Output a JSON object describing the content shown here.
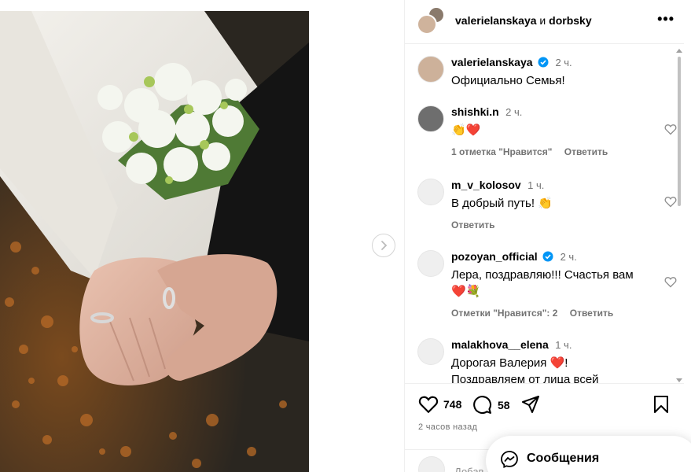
{
  "post": {
    "owner1": "valerielanskaya",
    "conj": "и",
    "owner2": "dorbsky",
    "more": "•••"
  },
  "comments": [
    {
      "user": "valerielanskaya",
      "time": "2 ч.",
      "text": "Официально Семья!",
      "verified": true
    },
    {
      "user": "shishki.n",
      "time": "2 ч.",
      "text": "👏❤️",
      "likes": "1 отметка \"Нравится\"",
      "reply": "Ответить"
    },
    {
      "user": "m_v_kolosov",
      "time": "1 ч.",
      "text": "В добрый путь! 👏",
      "reply": "Ответить"
    },
    {
      "user": "pozoyan_official",
      "time": "2 ч.",
      "text": "Лера, поздравляю!!! Счастья вам❤️💐",
      "likes": "Отметки \"Нравится\": 2",
      "reply": "Ответить",
      "verified": true
    },
    {
      "user": "malakhova__elena",
      "time": "1 ч.",
      "text": "Дорогая Валерия ❤️!",
      "text2": "Поздравляем от лица всей"
    }
  ],
  "actions": {
    "like_count": "748",
    "comment_count": "58",
    "posted_ago": "2 часов назад"
  },
  "add_comment": {
    "placeholder": "Добав"
  },
  "messages": {
    "label": "Сообщения"
  },
  "colors": {
    "verified": "#0095f6",
    "heart": "#e0245e",
    "muted": "#737373"
  }
}
